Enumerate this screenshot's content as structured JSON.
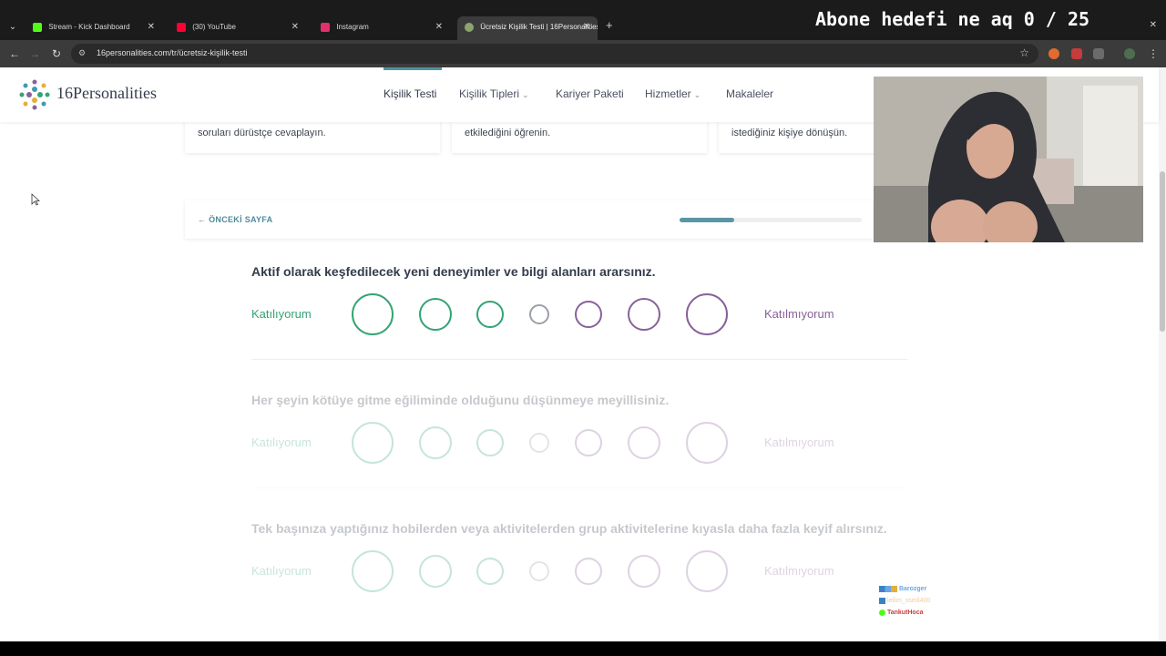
{
  "stream_overlay": {
    "goal_text": "Abone hedefi ne aq 0 / 25"
  },
  "browser": {
    "tabs": [
      {
        "label": "Stream - Kick Dashboard",
        "icon": "kick-icon",
        "color": "#53fc18"
      },
      {
        "label": "(30) YouTube",
        "icon": "youtube-icon",
        "color": "#ff0033"
      },
      {
        "label": "Instagram",
        "icon": "instagram-icon",
        "color": "#e1306c"
      },
      {
        "label": "Ücretsiz Kişilik Testi | 16Personalities",
        "icon": "16personalities-icon",
        "color": "#8ca56e"
      }
    ],
    "url": "16personalities.com/tr/ücretsiz-kişilik-testi"
  },
  "site": {
    "logo_text": "16Personalities",
    "nav": [
      {
        "label": "Kişilik Testi",
        "active": true,
        "has_dropdown": false
      },
      {
        "label": "Kişilik Tipleri",
        "active": false,
        "has_dropdown": true
      },
      {
        "label": "Kariyer Paketi",
        "active": false,
        "has_dropdown": false
      },
      {
        "label": "Hizmetler",
        "active": false,
        "has_dropdown": true
      },
      {
        "label": "Makaleler",
        "active": false,
        "has_dropdown": false
      }
    ],
    "accent_color": "#4e93a0"
  },
  "info_cards": [
    {
      "text": "soruları dürüstçe cevaplayın."
    },
    {
      "text": "etkilediğini öğrenin."
    },
    {
      "text": "istediğiniz kişiye dönüşün."
    }
  ],
  "test": {
    "prev_page_label": "ÖNCEKİ SAYFA",
    "progress": 0.3,
    "agree_color": "#33a474",
    "disagree_color": "#88619a",
    "questions": [
      {
        "text": "Aktif olarak keşfedilecek yeni deneyimler ve bilgi alanları ararsınız.",
        "agree_label": "Katılıyorum",
        "disagree_label": "Katılmıyorum",
        "active": true
      },
      {
        "text": "Her şeyin kötüye gitme eğiliminde olduğunu düşünmeye meyillisiniz.",
        "agree_label": "Katılıyorum",
        "disagree_label": "Katılmıyorum",
        "active": false
      },
      {
        "text": "Tek başınıza yaptığınız hobilerden veya aktivitelerden grup aktivitelerine kıyasla daha fazla keyif alırsınız.",
        "agree_label": "Katılıyorum",
        "disagree_label": "Katılmıyorum",
        "active": false
      }
    ]
  },
  "chat": [
    {
      "user": "Barozger",
      "color": "#6aa6e8"
    },
    {
      "user": "leilim_ssmli400",
      "color": "#e7a04a"
    },
    {
      "user": "TankutHoca",
      "color": "#c94040"
    }
  ]
}
